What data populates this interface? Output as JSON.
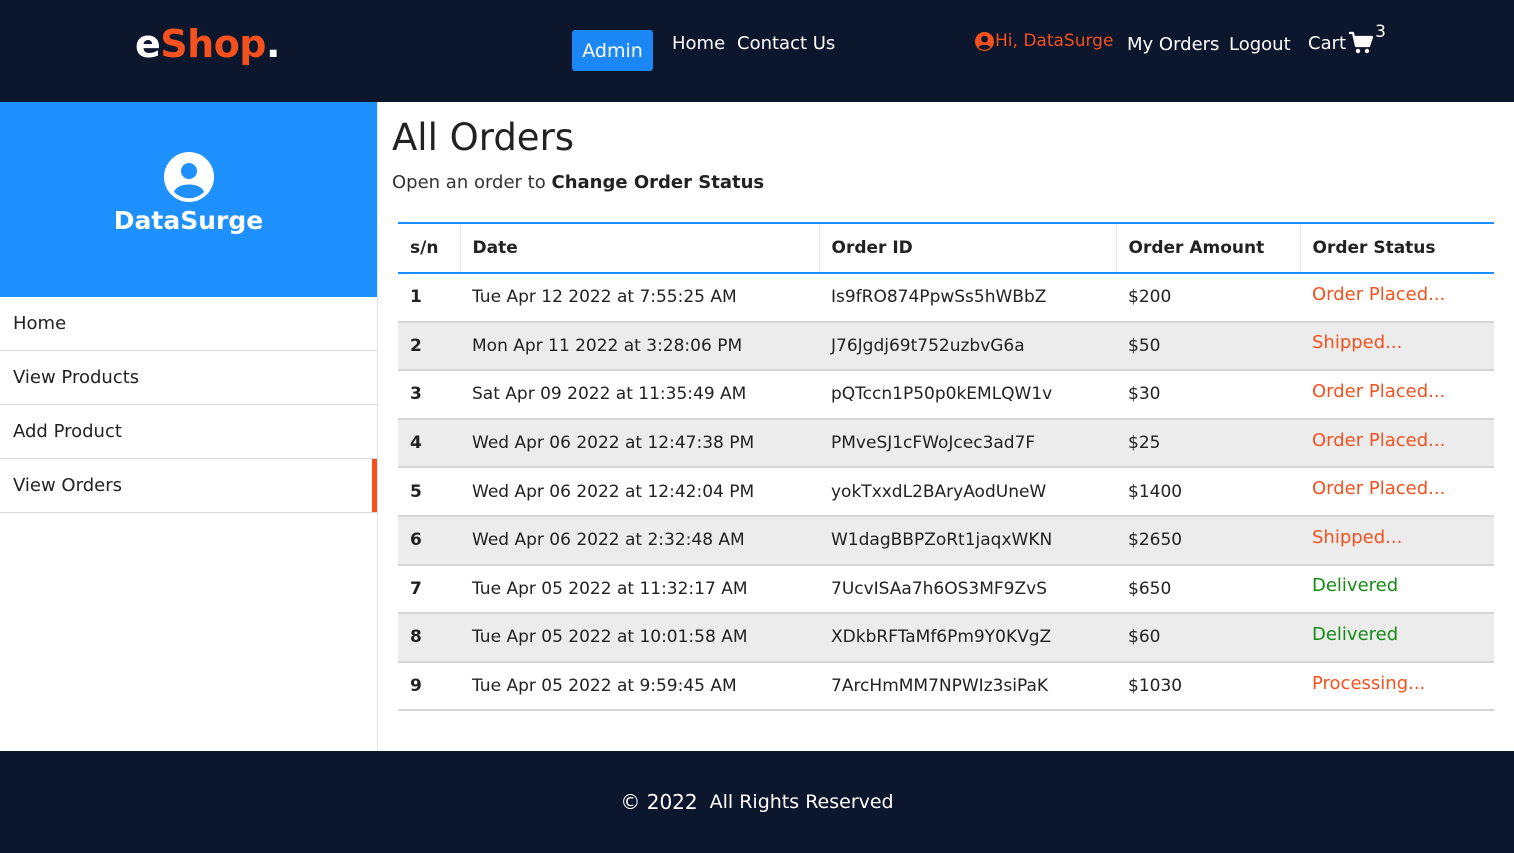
{
  "header": {
    "logo_prefix": "e",
    "logo_brand": "Shop",
    "logo_dot": ".",
    "admin_label": "Admin",
    "nav": {
      "home": "Home",
      "contact": "Contact Us"
    },
    "greeting": "Hi, DataSurge",
    "my_orders": "My Orders",
    "logout": "Logout",
    "cart_label": "Cart",
    "cart_count": "3",
    "icons": {
      "user": "user-circle-icon",
      "cart": "shopping-cart-icon"
    }
  },
  "sidebar": {
    "profile_name": "DataSurge",
    "profile_icon": "user-circle-icon",
    "items": [
      {
        "label": "Home"
      },
      {
        "label": "View Products"
      },
      {
        "label": "Add Product"
      },
      {
        "label": "View Orders",
        "active": true
      }
    ]
  },
  "main": {
    "title": "All Orders",
    "subtitle_prefix": "Open an order to",
    "subtitle_bold": "Change Order Status",
    "columns": [
      "s/n",
      "Date",
      "Order ID",
      "Order Amount",
      "Order Status"
    ],
    "orders": [
      {
        "sn": "1",
        "date": "Tue Apr 12 2022 at 7:55:25 AM",
        "id": "Is9fRO874PpwSs5hWBbZ",
        "amount": "$200",
        "status": "Order Placed...",
        "status_color": "#f4511e"
      },
      {
        "sn": "2",
        "date": "Mon Apr 11 2022 at 3:28:06 PM",
        "id": "J76Jgdj69t752uzbvG6a",
        "amount": "$50",
        "status": "Shipped...",
        "status_color": "#f4511e"
      },
      {
        "sn": "3",
        "date": "Sat Apr 09 2022 at 11:35:49 AM",
        "id": "pQTccn1P50p0kEMLQW1v",
        "amount": "$30",
        "status": "Order Placed...",
        "status_color": "#f4511e"
      },
      {
        "sn": "4",
        "date": "Wed Apr 06 2022 at 12:47:38 PM",
        "id": "PMveSJ1cFWoJcec3ad7F",
        "amount": "$25",
        "status": "Order Placed...",
        "status_color": "#f4511e"
      },
      {
        "sn": "5",
        "date": "Wed Apr 06 2022 at 12:42:04 PM",
        "id": "yokTxxdL2BAryAodUneW",
        "amount": "$1400",
        "status": "Order Placed...",
        "status_color": "#f4511e"
      },
      {
        "sn": "6",
        "date": "Wed Apr 06 2022 at 2:32:48 AM",
        "id": "W1dagBBPZoRt1jaqxWKN",
        "amount": "$2650",
        "status": "Shipped...",
        "status_color": "#f4511e"
      },
      {
        "sn": "7",
        "date": "Tue Apr 05 2022 at 11:32:17 AM",
        "id": "7UcvISAa7h6OS3MF9ZvS",
        "amount": "$650",
        "status": "Delivered",
        "status_color": "#158a15"
      },
      {
        "sn": "8",
        "date": "Tue Apr 05 2022 at 10:01:58 AM",
        "id": "XDkbRFTaMf6Pm9Y0KVgZ",
        "amount": "$60",
        "status": "Delivered",
        "status_color": "#158a15"
      },
      {
        "sn": "9",
        "date": "Tue Apr 05 2022 at 9:59:45 AM",
        "id": "7ArcHmMM7NPWIz3siPaK",
        "amount": "$1030",
        "status": "Processing...",
        "status_color": "#f4511e"
      }
    ]
  },
  "footer": {
    "year": "© 2022",
    "text": "All Rights Reserved"
  },
  "colors": {
    "dark_nav": "#0c162c",
    "accent_orange": "#f4511e",
    "primary_blue": "#1e90ff",
    "delivered_green": "#158a15"
  }
}
